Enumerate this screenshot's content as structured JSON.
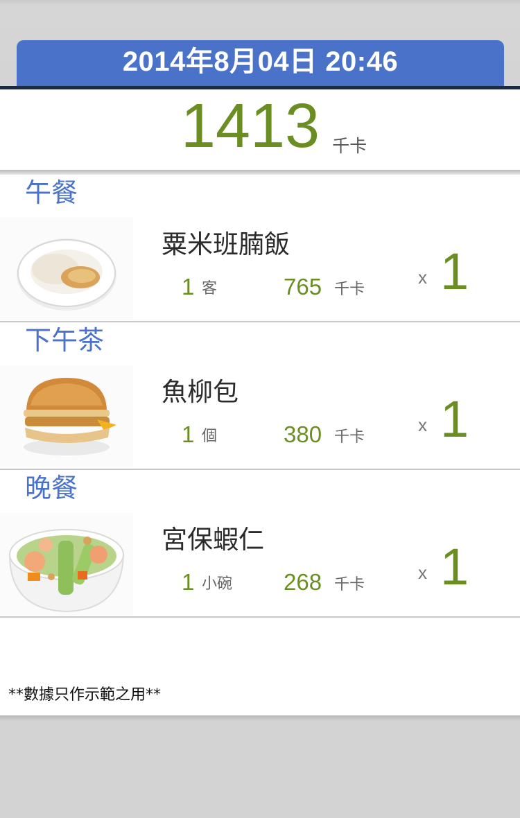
{
  "header": {
    "datetime": "2014年8月04日 20:46"
  },
  "summary": {
    "total_kcal": "1413",
    "unit": "千卡"
  },
  "meals": [
    {
      "title": "午餐",
      "food": {
        "name": "粟米班腩飯",
        "qty": "1",
        "qty_unit": "客",
        "kcal": "765",
        "kcal_unit": "千卡",
        "times": "x",
        "count": "1",
        "image_icon": "rice-plate-image"
      }
    },
    {
      "title": "下午茶",
      "food": {
        "name": "魚柳包",
        "qty": "1",
        "qty_unit": "個",
        "kcal": "380",
        "kcal_unit": "千卡",
        "times": "x",
        "count": "1",
        "image_icon": "burger-image"
      }
    },
    {
      "title": "晚餐",
      "food": {
        "name": "宮保蝦仁",
        "qty": "1",
        "qty_unit": "小碗",
        "kcal": "268",
        "kcal_unit": "千卡",
        "times": "x",
        "count": "1",
        "image_icon": "shrimp-bowl-image"
      }
    }
  ],
  "footer": {
    "disclaimer": "**數據只作示範之用**"
  },
  "colors": {
    "accent_blue": "#4a72c8",
    "value_green": "#6b8e23"
  }
}
